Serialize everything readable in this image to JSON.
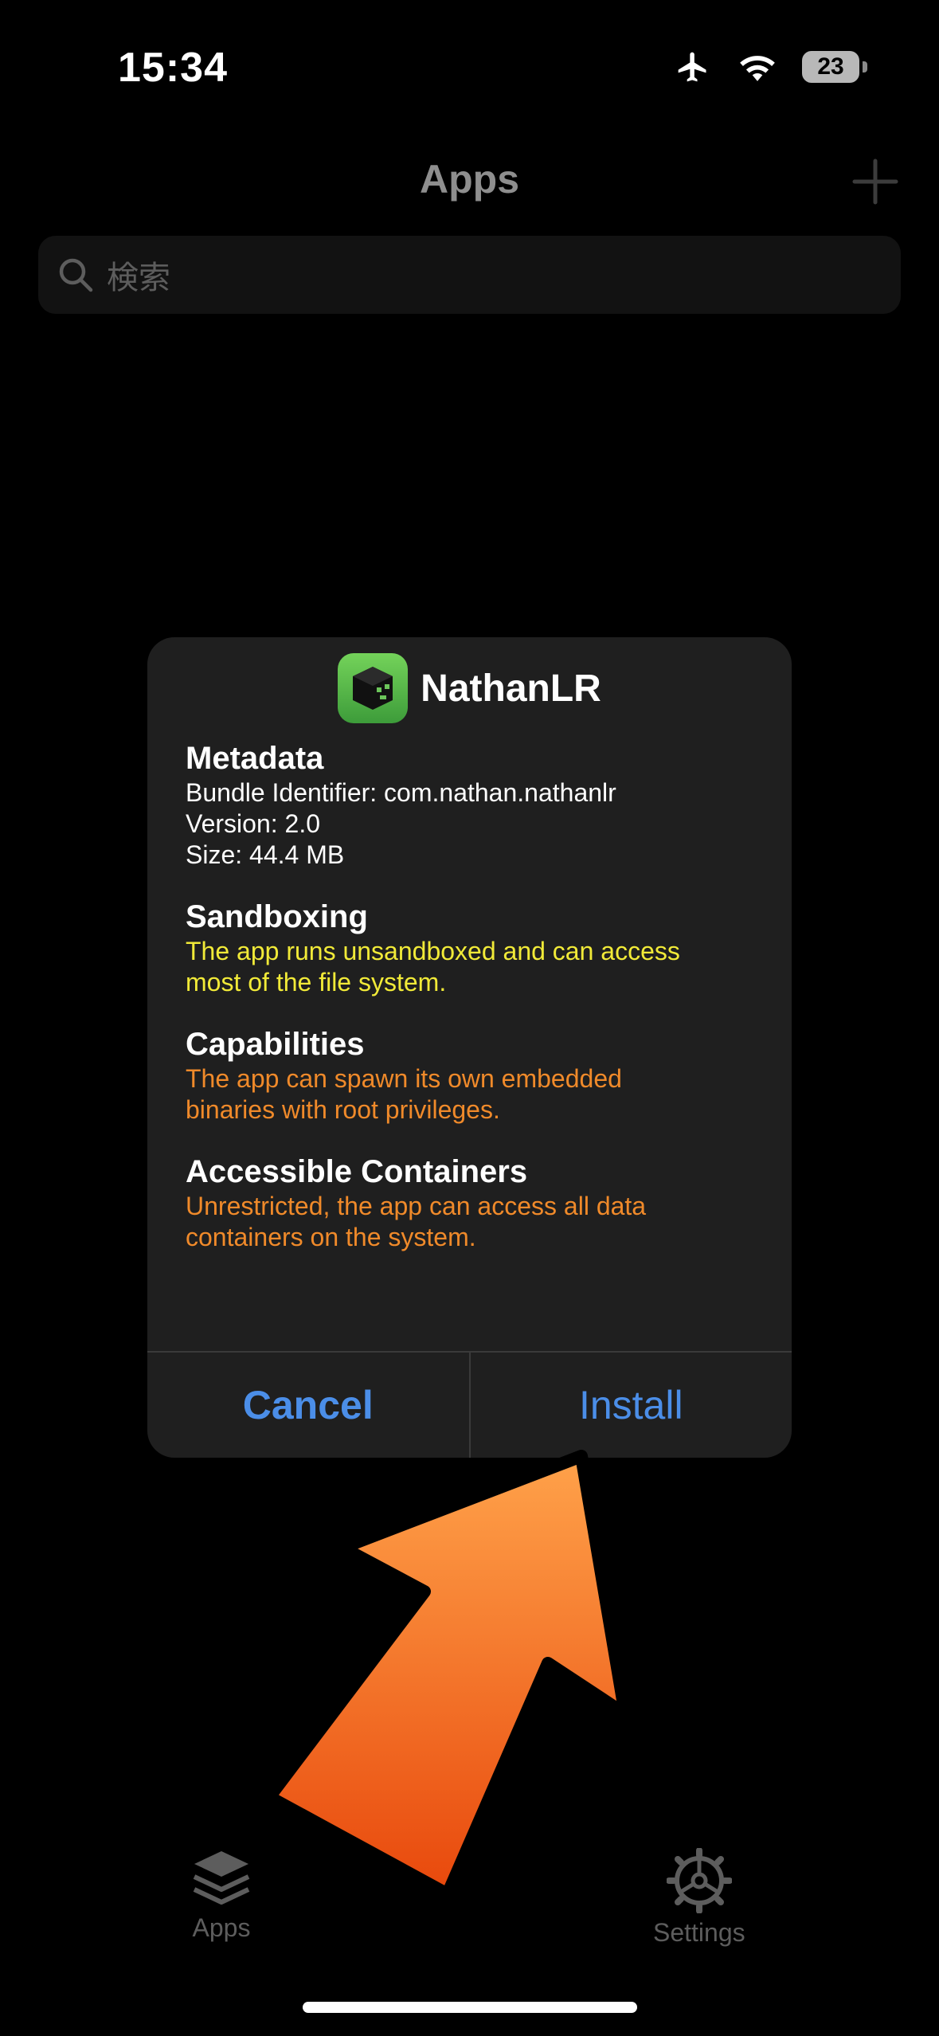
{
  "status_bar": {
    "time": "15:34",
    "battery": "23"
  },
  "nav": {
    "title": "Apps"
  },
  "search": {
    "placeholder": "検索"
  },
  "dialog": {
    "app_name": "NathanLR",
    "metadata": {
      "title": "Metadata",
      "bundle": "Bundle Identifier: com.nathan.nathanlr",
      "version": "Version: 2.0",
      "size": "Size: 44.4 MB"
    },
    "sandboxing": {
      "title": "Sandboxing",
      "line1": "The app runs unsandboxed and can access",
      "line2": "most of the file system."
    },
    "capabilities": {
      "title": "Capabilities",
      "line1": "The app can spawn its own embedded",
      "line2": "binaries with root privileges."
    },
    "containers": {
      "title": "Accessible Containers",
      "line1": "Unrestricted, the app can access all data",
      "line2": "containers on the system."
    },
    "cancel_label": "Cancel",
    "install_label": "Install"
  },
  "tabbar": {
    "apps_label": "Apps",
    "settings_label": "Settings"
  },
  "colors": {
    "accent": "#4b8ee8",
    "warning_yellow": "#f1ea38",
    "warning_orange": "#f08a2a",
    "arrow": "#f7812a"
  }
}
